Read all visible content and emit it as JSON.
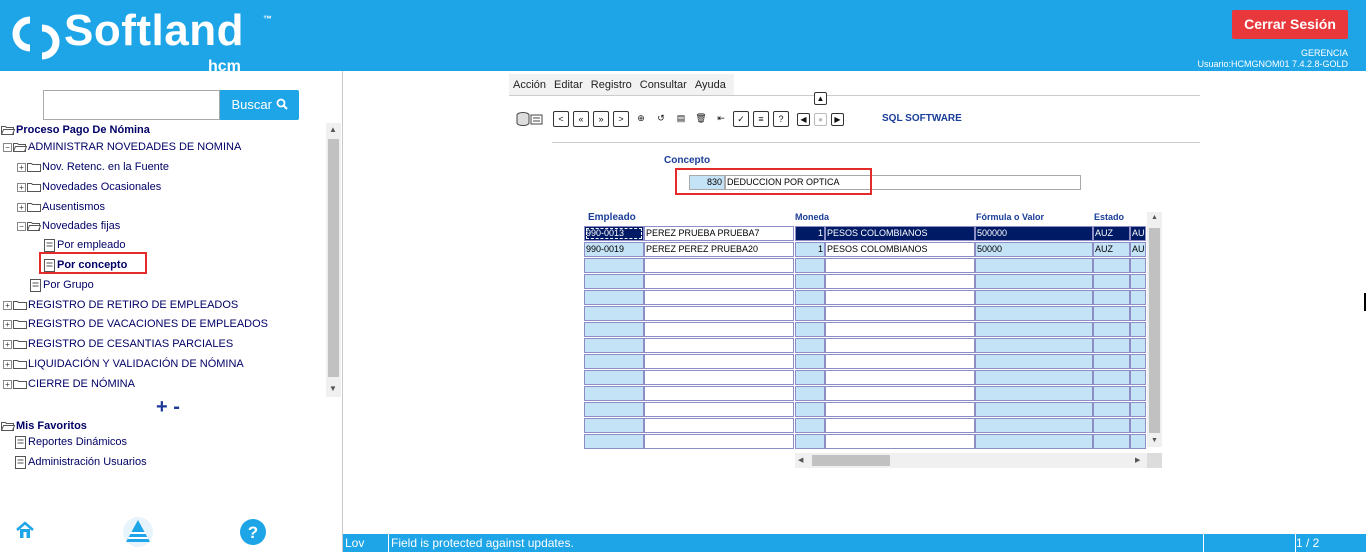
{
  "header": {
    "brand": "Softland",
    "brand_tm": "™",
    "brand_sub": "hcm",
    "logout_label": "Cerrar Sesión",
    "company": "GERENCIA",
    "user": "Usuario:HCMGNOM01 7.4.2.8-GOLD",
    "colors": {
      "bar": "#1ea5e8",
      "logout": "#e8383b"
    }
  },
  "sidebar": {
    "search": {
      "value": "",
      "button_label": "Buscar"
    },
    "tree": [
      {
        "label": "Proceso Pago De Nómina",
        "bold": true
      },
      {
        "label": "ADMINISTRAR NOVEDADES DE NOMINA"
      },
      {
        "label": "Nov. Retenc. en la Fuente"
      },
      {
        "label": "Novedades Ocasionales"
      },
      {
        "label": "Ausentismos"
      },
      {
        "label": "Novedades fijas"
      },
      {
        "label": "Por empleado"
      },
      {
        "label": "Por concepto",
        "bold": true
      },
      {
        "label": "Por Grupo"
      },
      {
        "label": "REGISTRO DE RETIRO DE EMPLEADOS"
      },
      {
        "label": "REGISTRO DE VACACIONES DE EMPLEADOS"
      },
      {
        "label": "REGISTRO DE CESANTIAS PARCIALES"
      },
      {
        "label": "LIQUIDACIÓN Y VALIDACIÓN DE NÓMINA"
      },
      {
        "label": "CIERRE DE NÓMINA"
      }
    ],
    "zoom_controls": "+ -",
    "favorites_title": "Mis Favoritos",
    "favorites": [
      {
        "label": "Reportes Dinámicos"
      },
      {
        "label": "Administración Usuarios"
      }
    ],
    "bottom_icons": [
      "home-icon",
      "app-logo-icon",
      "help-icon"
    ]
  },
  "main": {
    "menu": [
      "Acción",
      "Editar",
      "Registro",
      "Consultar",
      "Ayuda"
    ],
    "toolbar_brand": "SQL SOFTWARE",
    "concepto_label": "Concepto",
    "concepto_code": "830",
    "concepto_name": "DEDUCCION POR OPTICA",
    "columns": {
      "empleado": "Empleado",
      "moneda": "Moneda",
      "formula": "Fórmula o Valor",
      "estado": "Estado"
    },
    "rows": [
      {
        "code": "990-0013",
        "name": "PEREZ PRUEBA PRUEBA7",
        "moneda_num": "1",
        "moneda": "PESOS COLOMBIANOS",
        "valor": "500000",
        "estado": "AUZ",
        "extra": "AU"
      },
      {
        "code": "990-0019",
        "name": "PEREZ PEREZ PRUEBA20",
        "moneda_num": "1",
        "moneda": "PESOS COLOMBIANOS",
        "valor": "50000",
        "estado": "AUZ",
        "extra": "AU"
      }
    ]
  },
  "status": {
    "mode": "Lov",
    "message": "Field is protected against updates.",
    "record": "1 / 2"
  }
}
